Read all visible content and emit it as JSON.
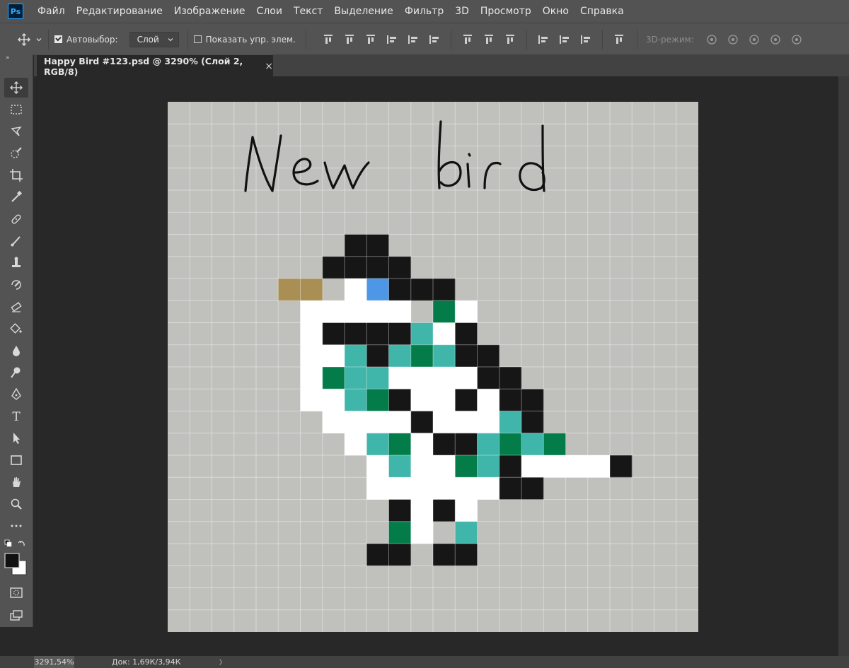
{
  "app": {
    "logo": "Ps"
  },
  "menu": [
    "Файл",
    "Редактирование",
    "Изображение",
    "Слои",
    "Текст",
    "Выделение",
    "Фильтр",
    "3D",
    "Просмотр",
    "Окно",
    "Справка"
  ],
  "options": {
    "autoselect_label": "Автовыбор:",
    "autoselect_checked": true,
    "layer_select_value": "Слой",
    "show_controls_label": "Показать упр. элем.",
    "mode_3d_label": "3D-режим:"
  },
  "document": {
    "tab_title": "Happy Bird #123.psd @ 3290% (Слой 2, RGB/8)",
    "close_glyph": "×",
    "handwritten_text": "New bird"
  },
  "status": {
    "zoom": "3291,54%",
    "doc_size": "Док: 1,69К/3,94К",
    "arrow": "〉"
  },
  "colors": {
    "canvas_bg": "#c0c0bd",
    "K": "#161616",
    "W": "#ffffff",
    "T": "#40b5aa",
    "G": "#037c4a",
    "B": "#4e97e6",
    "Y": "#a98f53"
  },
  "pixel_art": {
    "grid": 24,
    "rows": [
      "........................",
      "........................",
      "........................",
      "........................",
      "........................",
      "........................",
      "........KK..............",
      ".......KKKK.............",
      ".....YY.WBKKK...........",
      "......WWWWW.GW..........",
      "......WKKKKTWK..........",
      "......WWTKTGTKK.........",
      "......WGTTWWWWKK........",
      "......WWTGKWWKWKK.......",
      ".......WWWWKWWWTK.......",
      "........WTGWKKTGTG......",
      ".........WTWWGTKWWWWK...",
      ".........WWWWWWKK.......",
      "..........KWKW..........",
      "..........GW.T..........",
      ".........KK.KK..........",
      "........................",
      "........................",
      "........................"
    ]
  }
}
